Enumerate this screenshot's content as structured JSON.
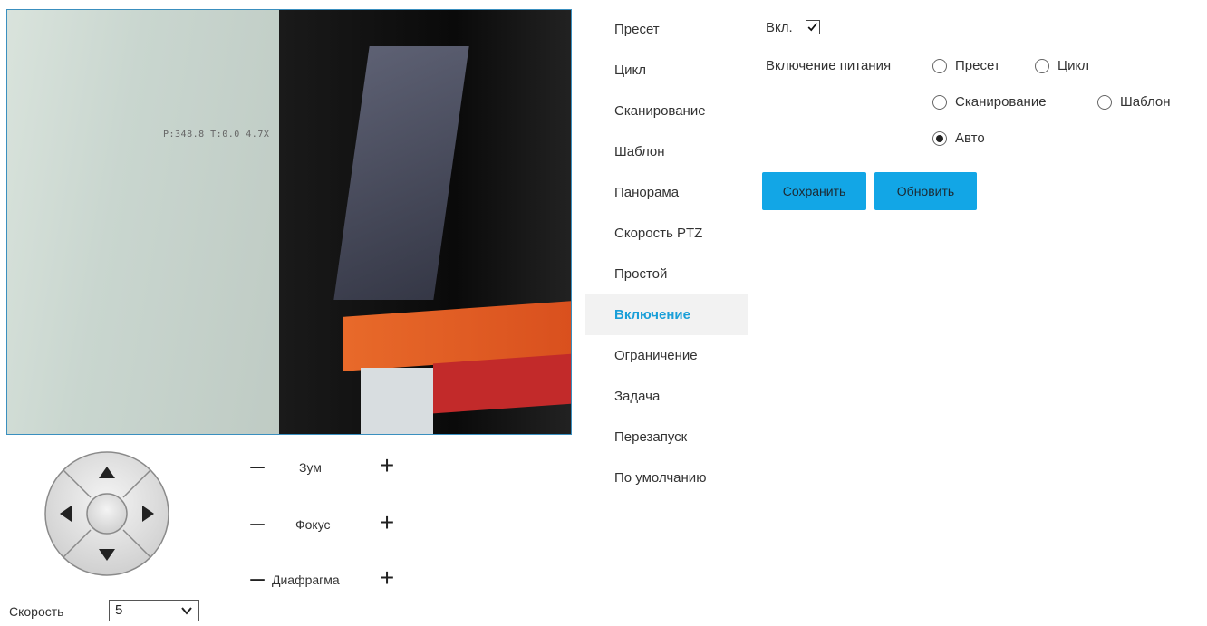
{
  "video": {
    "osd_text": "P:348.8 T:0.0 4.7X"
  },
  "ptz": {
    "zoom_label": "Зум",
    "focus_label": "Фокус",
    "iris_label": "Диафрагма",
    "minus_symbol": "–",
    "plus_symbol": "+",
    "speed_label": "Скорость",
    "speed_value": "5"
  },
  "menu": {
    "items": [
      {
        "label": "Пресет"
      },
      {
        "label": "Цикл"
      },
      {
        "label": "Сканирование"
      },
      {
        "label": "Шаблон"
      },
      {
        "label": "Панорама"
      },
      {
        "label": "Скорость PTZ"
      },
      {
        "label": "Простой"
      },
      {
        "label": "Включение",
        "active": true
      },
      {
        "label": "Ограничение"
      },
      {
        "label": "Задача"
      },
      {
        "label": "Перезапуск"
      },
      {
        "label": "По умолчанию"
      }
    ],
    "active_color": "#1a9fd8"
  },
  "form": {
    "enable_label": "Вкл.",
    "enable_checked": true,
    "power_on_label": "Включение питания",
    "options": [
      {
        "label": "Пресет",
        "selected": false
      },
      {
        "label": "Цикл",
        "selected": false
      },
      {
        "label": "Сканирование",
        "selected": false
      },
      {
        "label": "Шаблон",
        "selected": false
      },
      {
        "label": "Авто",
        "selected": true
      }
    ],
    "save_label": "Сохранить",
    "refresh_label": "Обновить",
    "button_color": "#12a6e6"
  }
}
